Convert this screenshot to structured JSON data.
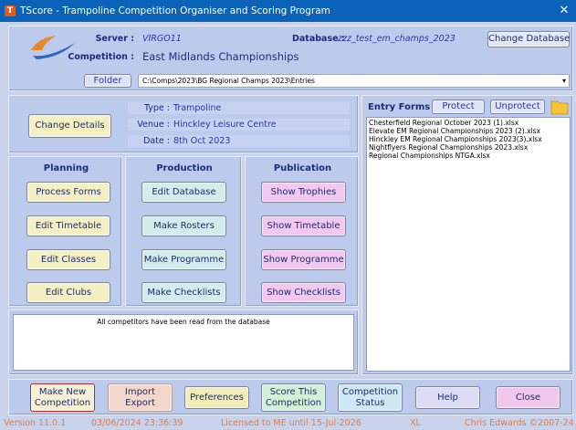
{
  "window": {
    "title": "TScore - Trampoline Competition Organiser and Scoring Program",
    "close": "✕"
  },
  "header": {
    "server_label": "Server :",
    "server_value": "VIRGO11",
    "database_label": "Database :",
    "database_value": "zzz_test_em_champs_2023",
    "change_database": "Change Database",
    "competition_label": "Competition :",
    "competition_value": "East Midlands Championships",
    "folder_button": "Folder",
    "folder_path": "C:\\Comps\\2023\\BG Regional Champs 2023\\Entries"
  },
  "details": {
    "change_details": "Change Details",
    "type_label": "Type :",
    "type_value": "Trampoline",
    "venue_label": "Venue :",
    "venue_value": "Hinckley Leisure Centre",
    "date_label": "Date :",
    "date_value": "8th Oct 2023"
  },
  "planning": {
    "title": "Planning",
    "buttons": [
      "Process Forms",
      "Edit Timetable",
      "Edit Classes",
      "Edit Clubs"
    ]
  },
  "production": {
    "title": "Production",
    "buttons": [
      "Edit Database",
      "Make Rosters",
      "Make Programme",
      "Make Checklists"
    ]
  },
  "publication": {
    "title": "Publication",
    "buttons": [
      "Show Trophies",
      "Show Timetable",
      "Show Programme",
      "Show Checklists"
    ]
  },
  "message": "All competitors have been read from the database",
  "entry_forms": {
    "title": "Entry Forms",
    "protect": "Protect",
    "unprotect": "Unprotect",
    "files": [
      "Chesterfield Regional  October 2023 (1).xlsx",
      "Elevate EM Regional Championships 2023 (2).xlsx",
      "Hinckley EM Regional Championships 2023(3).xlsx",
      "Nightflyers Regional Championships 2023.xlsx",
      "Regional Championships NTGA.xlsx"
    ]
  },
  "bottom": {
    "new_comp_1": "Make New",
    "new_comp_2": "Competition",
    "import_1": "Import",
    "import_2": "Export",
    "preferences": "Preferences",
    "score_1": "Score This",
    "score_2": "Competition",
    "status_1": "Competition",
    "status_2": "Status",
    "help": "Help",
    "close": "Close"
  },
  "status": {
    "version": "Version 11.0.1",
    "datetime": "03/06/2024  23:36:39",
    "license": "Licensed to ME until 15-Jul-2026",
    "xl": "XL",
    "copyright": "Chris Edwards ©2007-24"
  },
  "colors": {
    "titlebar": "#0a63b8",
    "panel": "#bccbeb",
    "planning": "#f4f0c4",
    "production": "#d3ecec",
    "publication": "#f2c8f0",
    "status_text": "#e77a43"
  }
}
